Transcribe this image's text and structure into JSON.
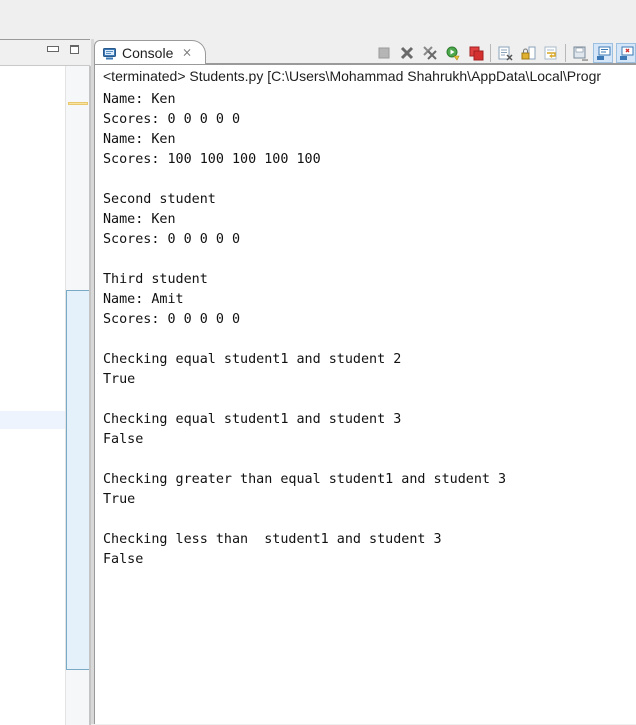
{
  "left_pane": {
    "minimize_label": "Minimize",
    "maximize_label": "Maximize"
  },
  "console": {
    "tab_label": "Console",
    "tab_icon": "console-monitor-icon",
    "close_icon": "close-icon",
    "status": "<terminated> Students.py [C:\\Users\\Mohammad Shahrukh\\AppData\\Local\\Progr",
    "toolbar": [
      {
        "name": "terminate-icon",
        "title": "Terminate"
      },
      {
        "name": "remove-launch-icon",
        "title": "Remove Launch"
      },
      {
        "name": "remove-all-terminated-icon",
        "title": "Remove All Terminated Launches"
      },
      {
        "name": "relaunch-icon",
        "title": "Relaunch"
      },
      {
        "name": "terminate-all-icon",
        "title": "Terminate All"
      },
      {
        "name": "clear-console-icon",
        "title": "Clear Console"
      },
      {
        "name": "scroll-lock-icon",
        "title": "Scroll Lock"
      },
      {
        "name": "word-wrap-icon",
        "title": "Word Wrap"
      },
      {
        "name": "save-output-icon",
        "title": "Save Output"
      },
      {
        "name": "show-console-stdout-icon",
        "title": "Show Console When Standard Out Changes"
      },
      {
        "name": "show-console-stderr-icon",
        "title": "Show Console When Standard Error Changes"
      }
    ],
    "output_lines": [
      "Name: Ken",
      "Scores: 0 0 0 0 0",
      "Name: Ken",
      "Scores: 100 100 100 100 100",
      "",
      "Second student",
      "Name: Ken",
      "Scores: 0 0 0 0 0",
      "",
      "Third student",
      "Name: Amit",
      "Scores: 0 0 0 0 0",
      "",
      "Checking equal student1 and student 2",
      "True",
      "",
      "Checking equal student1 and student 3",
      "False",
      "",
      "Checking greater than equal student1 and student 3",
      "True",
      "",
      "Checking less than  student1 and student 3",
      "False"
    ]
  }
}
